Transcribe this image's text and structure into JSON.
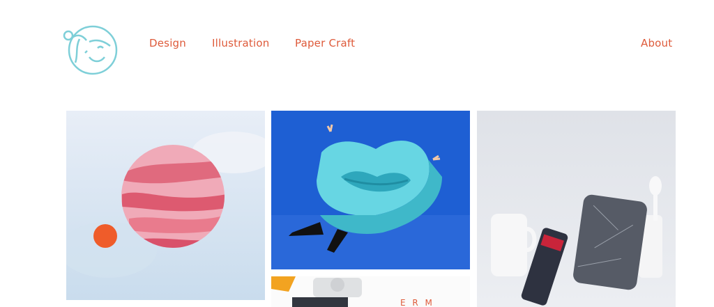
{
  "nav": {
    "items": [
      {
        "label": "Design"
      },
      {
        "label": "Illustration"
      },
      {
        "label": "Paper Craft"
      }
    ],
    "about_label": "About"
  },
  "logo": {
    "icon": "smiling-face-logo",
    "color": "#7ecfd8"
  },
  "colors": {
    "accent": "#de5a3a",
    "background": "#ffffff"
  },
  "gallery": {
    "tiles": [
      {
        "icon": "planet-illustration-image"
      },
      {
        "icon": "paper-lips-costume-image"
      },
      {
        "icon": "marble-paint-can-image"
      },
      {
        "icon": "paper-craft-partial-image",
        "partial_text": "E R M"
      }
    ]
  }
}
